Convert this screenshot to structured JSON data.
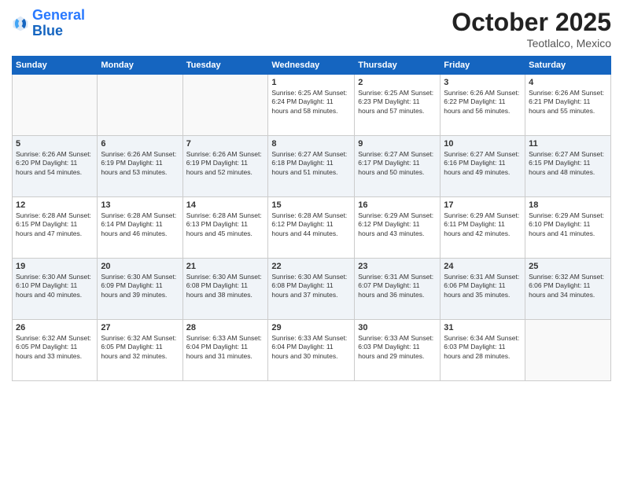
{
  "logo": {
    "line1": "General",
    "line2": "Blue"
  },
  "header": {
    "month": "October 2025",
    "location": "Teotlalco, Mexico"
  },
  "weekdays": [
    "Sunday",
    "Monday",
    "Tuesday",
    "Wednesday",
    "Thursday",
    "Friday",
    "Saturday"
  ],
  "weeks": [
    [
      {
        "day": "",
        "info": ""
      },
      {
        "day": "",
        "info": ""
      },
      {
        "day": "",
        "info": ""
      },
      {
        "day": "1",
        "info": "Sunrise: 6:25 AM\nSunset: 6:24 PM\nDaylight: 11 hours\nand 58 minutes."
      },
      {
        "day": "2",
        "info": "Sunrise: 6:25 AM\nSunset: 6:23 PM\nDaylight: 11 hours\nand 57 minutes."
      },
      {
        "day": "3",
        "info": "Sunrise: 6:26 AM\nSunset: 6:22 PM\nDaylight: 11 hours\nand 56 minutes."
      },
      {
        "day": "4",
        "info": "Sunrise: 6:26 AM\nSunset: 6:21 PM\nDaylight: 11 hours\nand 55 minutes."
      }
    ],
    [
      {
        "day": "5",
        "info": "Sunrise: 6:26 AM\nSunset: 6:20 PM\nDaylight: 11 hours\nand 54 minutes."
      },
      {
        "day": "6",
        "info": "Sunrise: 6:26 AM\nSunset: 6:19 PM\nDaylight: 11 hours\nand 53 minutes."
      },
      {
        "day": "7",
        "info": "Sunrise: 6:26 AM\nSunset: 6:19 PM\nDaylight: 11 hours\nand 52 minutes."
      },
      {
        "day": "8",
        "info": "Sunrise: 6:27 AM\nSunset: 6:18 PM\nDaylight: 11 hours\nand 51 minutes."
      },
      {
        "day": "9",
        "info": "Sunrise: 6:27 AM\nSunset: 6:17 PM\nDaylight: 11 hours\nand 50 minutes."
      },
      {
        "day": "10",
        "info": "Sunrise: 6:27 AM\nSunset: 6:16 PM\nDaylight: 11 hours\nand 49 minutes."
      },
      {
        "day": "11",
        "info": "Sunrise: 6:27 AM\nSunset: 6:15 PM\nDaylight: 11 hours\nand 48 minutes."
      }
    ],
    [
      {
        "day": "12",
        "info": "Sunrise: 6:28 AM\nSunset: 6:15 PM\nDaylight: 11 hours\nand 47 minutes."
      },
      {
        "day": "13",
        "info": "Sunrise: 6:28 AM\nSunset: 6:14 PM\nDaylight: 11 hours\nand 46 minutes."
      },
      {
        "day": "14",
        "info": "Sunrise: 6:28 AM\nSunset: 6:13 PM\nDaylight: 11 hours\nand 45 minutes."
      },
      {
        "day": "15",
        "info": "Sunrise: 6:28 AM\nSunset: 6:12 PM\nDaylight: 11 hours\nand 44 minutes."
      },
      {
        "day": "16",
        "info": "Sunrise: 6:29 AM\nSunset: 6:12 PM\nDaylight: 11 hours\nand 43 minutes."
      },
      {
        "day": "17",
        "info": "Sunrise: 6:29 AM\nSunset: 6:11 PM\nDaylight: 11 hours\nand 42 minutes."
      },
      {
        "day": "18",
        "info": "Sunrise: 6:29 AM\nSunset: 6:10 PM\nDaylight: 11 hours\nand 41 minutes."
      }
    ],
    [
      {
        "day": "19",
        "info": "Sunrise: 6:30 AM\nSunset: 6:10 PM\nDaylight: 11 hours\nand 40 minutes."
      },
      {
        "day": "20",
        "info": "Sunrise: 6:30 AM\nSunset: 6:09 PM\nDaylight: 11 hours\nand 39 minutes."
      },
      {
        "day": "21",
        "info": "Sunrise: 6:30 AM\nSunset: 6:08 PM\nDaylight: 11 hours\nand 38 minutes."
      },
      {
        "day": "22",
        "info": "Sunrise: 6:30 AM\nSunset: 6:08 PM\nDaylight: 11 hours\nand 37 minutes."
      },
      {
        "day": "23",
        "info": "Sunrise: 6:31 AM\nSunset: 6:07 PM\nDaylight: 11 hours\nand 36 minutes."
      },
      {
        "day": "24",
        "info": "Sunrise: 6:31 AM\nSunset: 6:06 PM\nDaylight: 11 hours\nand 35 minutes."
      },
      {
        "day": "25",
        "info": "Sunrise: 6:32 AM\nSunset: 6:06 PM\nDaylight: 11 hours\nand 34 minutes."
      }
    ],
    [
      {
        "day": "26",
        "info": "Sunrise: 6:32 AM\nSunset: 6:05 PM\nDaylight: 11 hours\nand 33 minutes."
      },
      {
        "day": "27",
        "info": "Sunrise: 6:32 AM\nSunset: 6:05 PM\nDaylight: 11 hours\nand 32 minutes."
      },
      {
        "day": "28",
        "info": "Sunrise: 6:33 AM\nSunset: 6:04 PM\nDaylight: 11 hours\nand 31 minutes."
      },
      {
        "day": "29",
        "info": "Sunrise: 6:33 AM\nSunset: 6:04 PM\nDaylight: 11 hours\nand 30 minutes."
      },
      {
        "day": "30",
        "info": "Sunrise: 6:33 AM\nSunset: 6:03 PM\nDaylight: 11 hours\nand 29 minutes."
      },
      {
        "day": "31",
        "info": "Sunrise: 6:34 AM\nSunset: 6:03 PM\nDaylight: 11 hours\nand 28 minutes."
      },
      {
        "day": "",
        "info": ""
      }
    ]
  ]
}
